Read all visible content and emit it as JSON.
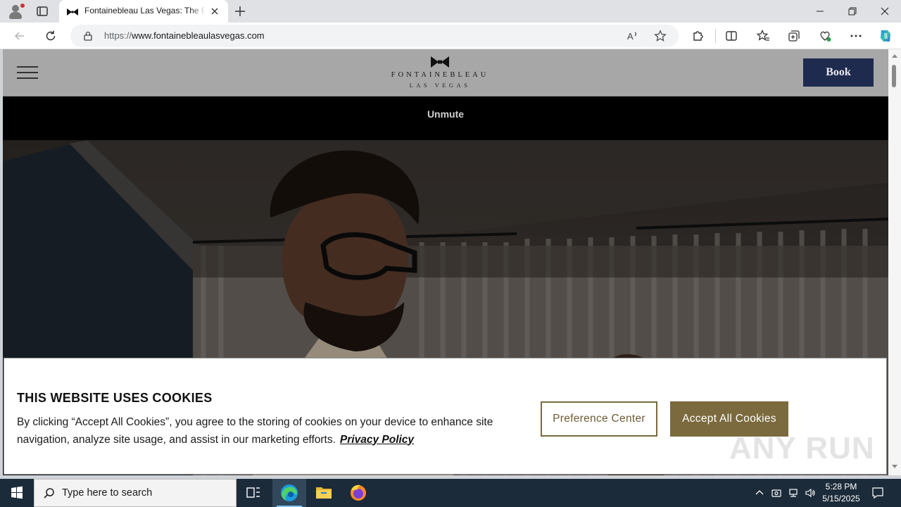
{
  "browser": {
    "tab_title": "Fontainebleau Las Vegas: The Best",
    "url_prefix": "https://",
    "url_domain": "www.fontainebleaulasvegas.com"
  },
  "site": {
    "logo_name": "FONTAINEBLEAU",
    "logo_sub": "LAS VEGAS",
    "book_label": "Book",
    "unmute_label": "Unmute"
  },
  "cookie": {
    "title": "THIS WEBSITE USES COOKIES",
    "text": "By clicking “Accept All Cookies”, you agree to the storing of cookies on your device to enhance site navigation, analyze site usage, and assist in our marketing efforts.",
    "privacy_link": "Privacy Policy",
    "preference_label": "Preference Center",
    "accept_label": "Accept All Cookies"
  },
  "watermark": "ANY RUN",
  "taskbar": {
    "search_placeholder": "Type here to search",
    "time": "5:28 PM",
    "date": "5/15/2025"
  }
}
